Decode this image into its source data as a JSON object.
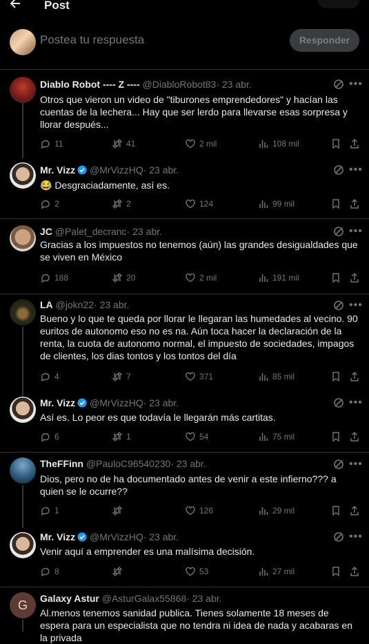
{
  "header": {
    "title": "Post"
  },
  "composer": {
    "placeholder": "Postea tu respuesta",
    "button": "Responder"
  },
  "tweets": [
    {
      "name": "Diablo Robot ---- Z ----",
      "handle": "@DiabloRobot83",
      "date": "· 23 abr.",
      "verified": false,
      "text": "Otros que vieron un video de \"tiburones emprendedores\" y hacían las cuentas de la lechera... Hay que ser lerdo para llevarse esas sorpresa y llorar después...",
      "replies": "11",
      "reposts": "41",
      "likes": "2 mil",
      "views": "108 mil"
    },
    {
      "name": "Mr. Vizz",
      "handle": "@MrVizzHQ",
      "date": "· 23 abr.",
      "verified": true,
      "text": "😂 Desgraciadamente, así es.",
      "replies": "2",
      "reposts": "2",
      "likes": "124",
      "views": "99 mil"
    },
    {
      "name": "JC",
      "handle": "@Palet_decranc",
      "date": "· 23 abr.",
      "verified": false,
      "text": "Gracias a los impuestos no tenemos (aún) las grandes desigualdades que se viven en México",
      "replies": "188",
      "reposts": "20",
      "likes": "2 mil",
      "views": "191 mil"
    },
    {
      "name": "LA",
      "handle": "@jokn22",
      "date": "· 23 abr.",
      "verified": false,
      "text": "Bueno y lo que te queda por llorar le llegaran las humedades al vecino. 90 euritos de autonomo eso no es na. Aún toca hacer la declaración de la renta, la cuota de autonomo normal, el impuesto de sociedades, impagos de clientes, los dias tontos y los tontos del día",
      "replies": "4",
      "reposts": "7",
      "likes": "371",
      "views": "85 mil"
    },
    {
      "name": "Mr. Vizz",
      "handle": "@MrVizzHQ",
      "date": "· 23 abr.",
      "verified": true,
      "text": "Así es. Lo peor es que todavía le llegarán más cartitas.",
      "replies": "6",
      "reposts": "1",
      "likes": "54",
      "views": "75 mil"
    },
    {
      "name": "TheFFinn",
      "handle": "@PauloC96540230",
      "date": "· 23 abr.",
      "verified": false,
      "text": "Dios, pero no de ha documentado antes de venir a este infierno??? a quien se le ocurre??",
      "replies": "1",
      "reposts": "",
      "likes": "126",
      "views": "29 mil"
    },
    {
      "name": "Mr. Vizz",
      "handle": "@MrVizzHQ",
      "date": "· 23 abr.",
      "verified": true,
      "text": "Venir aquí a emprender es una malísima decisión.",
      "replies": "8",
      "reposts": "",
      "likes": "53",
      "views": "27 mil"
    },
    {
      "name": "Galaxy Astur",
      "handle": "@AsturGalax55868",
      "date": "· 23 abr.",
      "verified": false,
      "avatar_letter": "G",
      "text": "Al.menos tenemos sanidad publica. Tienes solamente 18 meses de espera para un especialista que no tendra ni idea de nada y acabaras en la privada"
    }
  ]
}
